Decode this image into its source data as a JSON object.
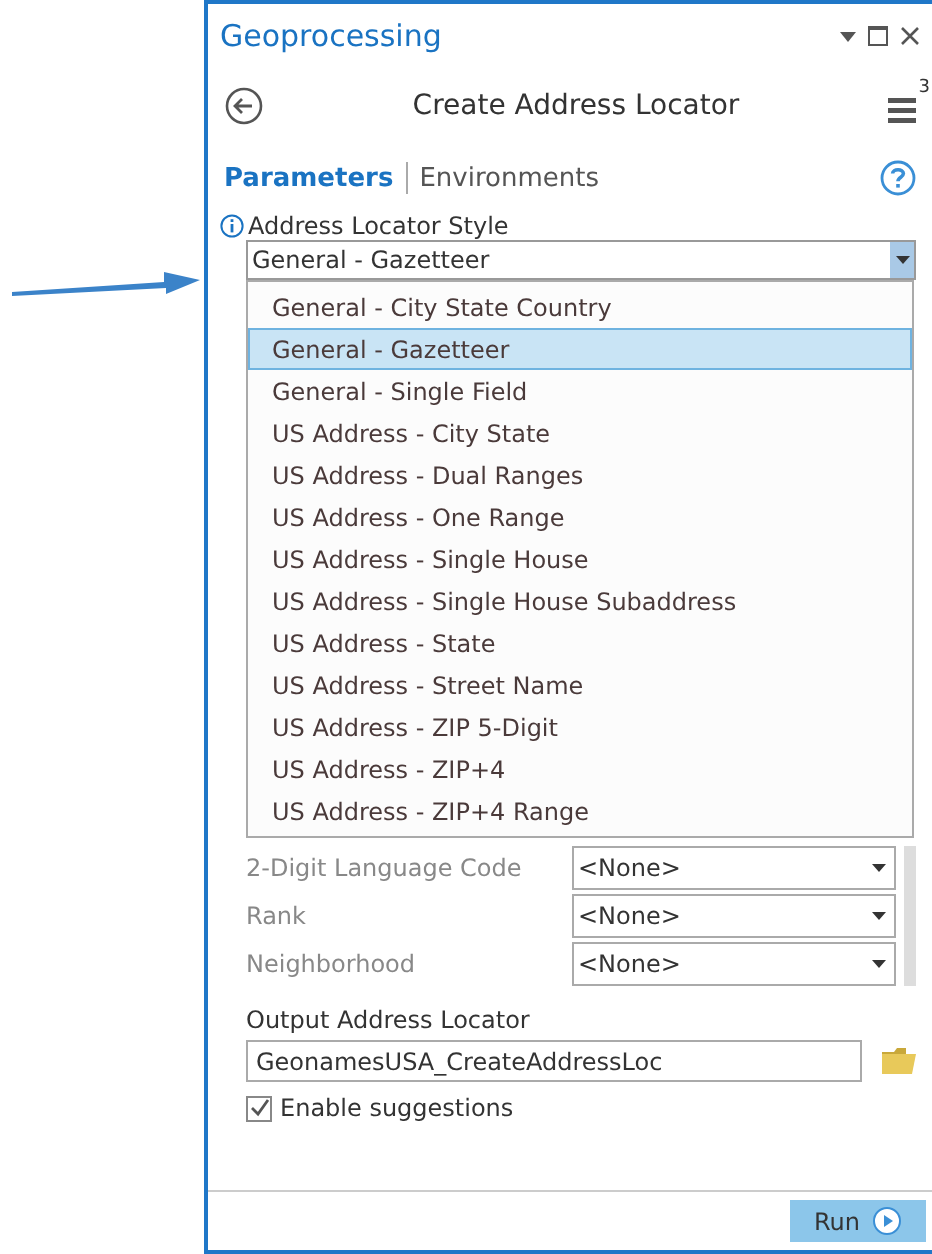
{
  "window": {
    "title": "Geoprocessing"
  },
  "tool": {
    "title": "Create Address Locator",
    "badge": "3"
  },
  "tabs": [
    {
      "label": "Parameters",
      "selected": true
    },
    {
      "label": "Environments",
      "selected": false
    }
  ],
  "style_field": {
    "label": "Address Locator Style",
    "value": "General - Gazetteer",
    "expanded": true,
    "options": [
      {
        "label": "General - City State Country",
        "selected": false
      },
      {
        "label": "General - Gazetteer",
        "selected": true
      },
      {
        "label": "General - Single Field",
        "selected": false
      },
      {
        "label": "US Address - City State",
        "selected": false
      },
      {
        "label": "US Address - Dual Ranges",
        "selected": false
      },
      {
        "label": "US Address - One Range",
        "selected": false
      },
      {
        "label": "US Address - Single House",
        "selected": false
      },
      {
        "label": "US Address - Single House Subaddress",
        "selected": false
      },
      {
        "label": "US Address - State",
        "selected": false
      },
      {
        "label": "US Address - Street Name",
        "selected": false
      },
      {
        "label": "US Address - ZIP 5-Digit",
        "selected": false
      },
      {
        "label": "US Address - ZIP+4",
        "selected": false
      },
      {
        "label": "US Address - ZIP+4 Range",
        "selected": false
      }
    ]
  },
  "parameters": [
    {
      "label": "2-Digit Language Code",
      "value": "<None>"
    },
    {
      "label": "Rank",
      "value": "<None>"
    },
    {
      "label": "Neighborhood",
      "value": "<None>"
    }
  ],
  "output": {
    "label": "Output Address Locator",
    "value": "GeonamesUSA_CreateAddressLoc"
  },
  "suggestions": {
    "label": "Enable suggestions",
    "checked": true
  },
  "run_button": "Run"
}
